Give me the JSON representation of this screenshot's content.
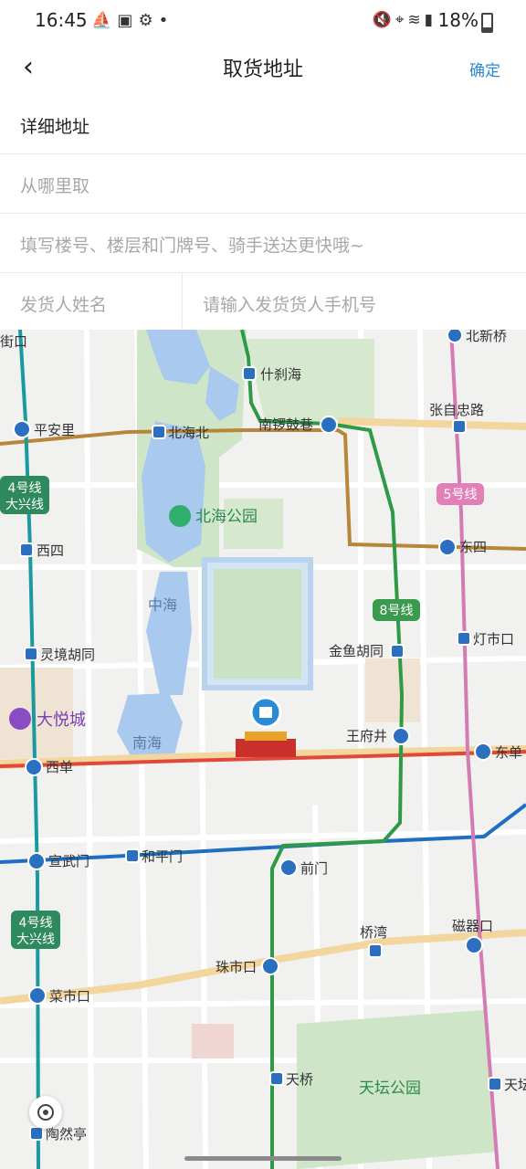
{
  "status_bar": {
    "time": "16:45",
    "left_icons": [
      "sailing-icon",
      "image-icon",
      "settings-icon",
      "dot-icon"
    ],
    "right_icons": [
      "mute-icon",
      "location-icon",
      "wifi-icon",
      "signal-icon"
    ],
    "battery": "18%"
  },
  "header": {
    "back_icon": "chevron-left-icon",
    "title": "取货地址",
    "confirm_label": "确定"
  },
  "form": {
    "section_label": "详细地址",
    "from_placeholder": "从哪里取",
    "detail_placeholder": "填写楼号、楼层和门牌号、骑手送达更快哦~",
    "sender_name_placeholder": "发货人姓名",
    "sender_phone_placeholder": "请输入发货货人手机号"
  },
  "map": {
    "stations": {
      "jiekou": "街口",
      "beixinqiao": "北新桥",
      "shichahai": "什刹海",
      "zhangzizhonglu": "张自忠路",
      "pinganli": "平安里",
      "beihaibei": "北海北",
      "nanluoguxiang": "南锣鼓巷",
      "xisi": "西四",
      "dongsi": "东四",
      "lingjinghutong": "灵境胡同",
      "dengshikou": "灯市口",
      "jinyuhutong": "金鱼胡同",
      "wangfujing": "王府井",
      "xidan": "西单",
      "dongdan": "东单",
      "xuanwumen": "宣武门",
      "hepingmen": "和平门",
      "qianmen": "前门",
      "qiaowan": "桥湾",
      "ciqikou": "磁器口",
      "zhushikou": "珠市口",
      "caishikou": "菜市口",
      "tianqiao": "天桥",
      "tiantan_dongmen": "天坛",
      "taoranting": "陶然亭"
    },
    "line_badges": {
      "line4_top": [
        "4号线",
        "大兴线"
      ],
      "line4_bottom": [
        "4号线",
        "大兴线"
      ],
      "line5": "5号线",
      "line8": "8号线"
    },
    "places": {
      "beihai_park": "北海公园",
      "zhonghai": "中海",
      "nanhai": "南海",
      "joy_city": "大悦城",
      "tiantan_park": "天坛公园"
    },
    "colors": {
      "line1": "#e0483a",
      "line2": "#1e6fc2",
      "line4": "#1a9aa0",
      "line5": "#d57bb4",
      "line6": "#b8863a",
      "line7": "#f0c888",
      "line8": "#2e9a45",
      "water": "#a9c9ef",
      "park": "#cfe5c8"
    }
  },
  "locate_icon": "locate-icon"
}
